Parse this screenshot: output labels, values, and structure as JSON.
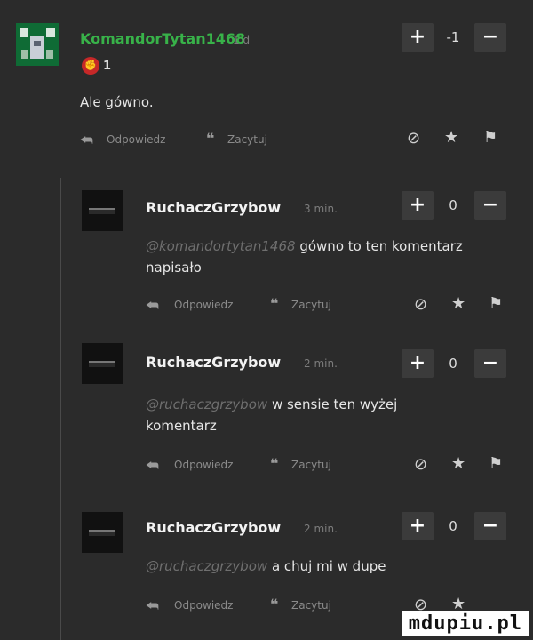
{
  "main_comment": {
    "username": "KomandorTytan1468",
    "time": "1 d",
    "score": "-1",
    "badge_count": "1",
    "text": "Ale gówno.",
    "actions": {
      "reply": "Odpowiedz",
      "quote": "Zacytuj"
    }
  },
  "replies": [
    {
      "username": "RuchaczGrzybow",
      "time": "3 min.",
      "score": "0",
      "mention": "@komandortytan1468",
      "text_line1": "gówno to ten komentarz",
      "text_line2": "napisało",
      "actions": {
        "reply": "Odpowiedz",
        "quote": "Zacytuj"
      }
    },
    {
      "username": "RuchaczGrzybow",
      "time": "2 min.",
      "score": "0",
      "mention": "@ruchaczgrzybow",
      "text_line1": "w sensie ten wyżej",
      "text_line2": "komentarz",
      "actions": {
        "reply": "Odpowiedz",
        "quote": "Zacytuj"
      }
    },
    {
      "username": "RuchaczGrzybow",
      "time": "2 min.",
      "score": "0",
      "mention": "@ruchaczgrzybow",
      "text_line1": "a chuj mi w dupe",
      "text_line2": "",
      "actions": {
        "reply": "Odpowiedz",
        "quote": "Zacytuj"
      }
    }
  ],
  "vote": {
    "plus": "+",
    "minus": "−"
  },
  "icons": {
    "reply": "reply-arrow-icon",
    "quote": "quote-marks-icon",
    "block": "block-icon",
    "favorite": "star-icon",
    "report": "flag-icon"
  },
  "watermark": "mdupiu.pl",
  "colors": {
    "background": "#2b2b2b",
    "username_main": "#38b249",
    "badge": "#c62828"
  }
}
